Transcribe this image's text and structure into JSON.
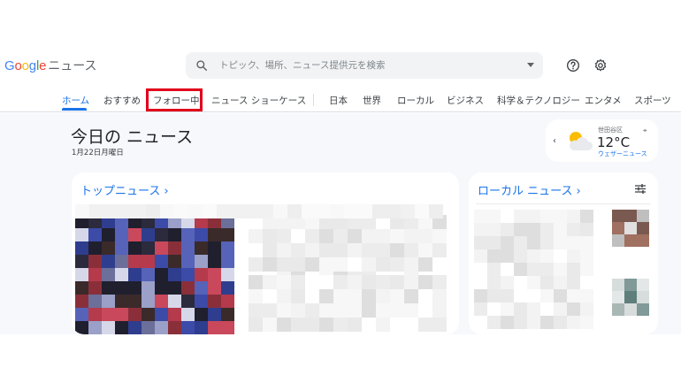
{
  "header": {
    "logo_google": [
      "G",
      "o",
      "o",
      "g",
      "l",
      "e"
    ],
    "logo_colors": [
      "#4285f4",
      "#ea4335",
      "#fbbc05",
      "#4285f4",
      "#34a853",
      "#ea4335"
    ],
    "logo_product": "ニュース",
    "search_placeholder": "トピック、場所、ニュース提供元を検索",
    "icons": [
      "search-icon",
      "help-icon",
      "gear-icon"
    ]
  },
  "nav": {
    "tabs": [
      "ホーム",
      "おすすめ",
      "フォロー中",
      "ニュース ショーケース",
      "日本",
      "世界",
      "ローカル",
      "ビジネス",
      "科学＆テクノロジー",
      "エンタメ",
      "スポーツ"
    ],
    "active_index": 0,
    "highlighted_index": 2,
    "highlight_color": "#e0001b"
  },
  "main": {
    "title": "今日の ニュース",
    "date": "1月22日月曜日"
  },
  "weather": {
    "location": "世田谷区",
    "temperature": "12°C",
    "link": "ウェザーニュース"
  },
  "top_news": {
    "title": "トップニュース",
    "chevron": "›"
  },
  "local_news": {
    "title": "ローカル ニュース",
    "chevron": "›"
  },
  "colors": {
    "accent": "#1a73e8",
    "background": "#f6f8fc"
  }
}
